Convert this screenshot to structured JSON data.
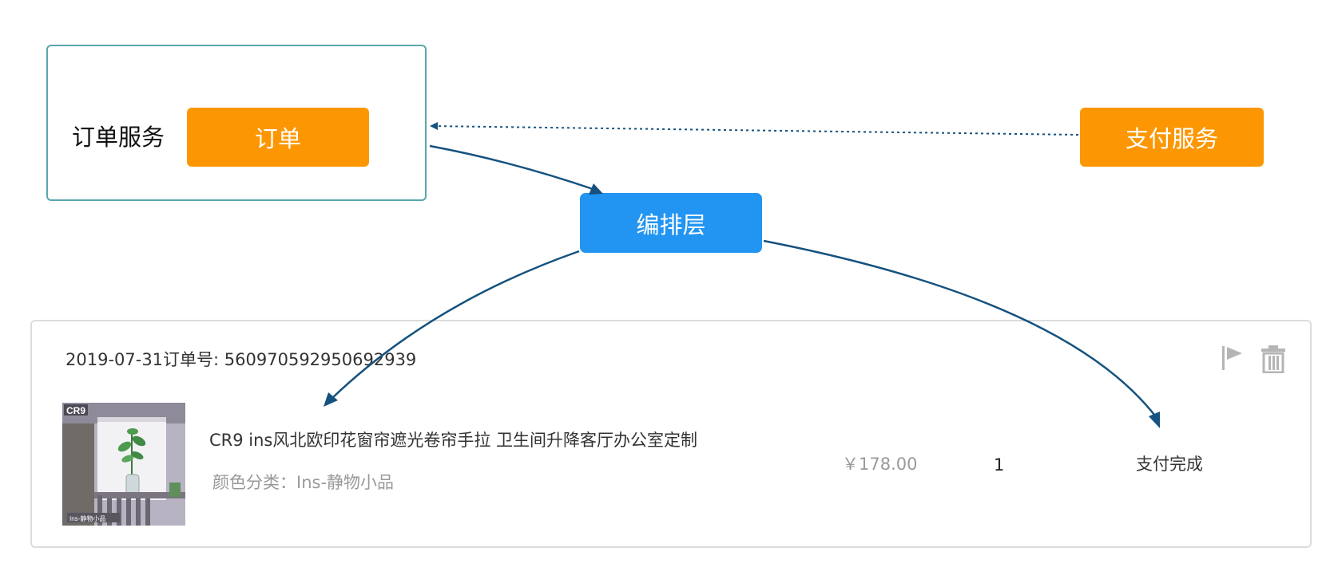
{
  "diagram": {
    "order_service_label": "订单服务",
    "order_button": "订单",
    "payment_service_button": "支付服务",
    "orchestration_layer": "编排层",
    "colors": {
      "service_box_border": "#5aa6ad",
      "service_button": "#fc9703",
      "orchestration": "#2195f1",
      "arrow": "#15527f"
    }
  },
  "order_card": {
    "meta": "2019-07-31订单号: 560970592950692939",
    "product": {
      "thumbnail_brand": "CR9",
      "thumbnail_caption": "Ins-静物小品",
      "title": "CR9 ins风北欧印花窗帘遮光卷帘手拉 卫生间升降客厅办公室定制",
      "variant": "颜色分类：Ins-静物小品"
    },
    "price": "￥178.00",
    "quantity": "1",
    "status": "支付完成",
    "icons": [
      "flag-icon",
      "trash-icon"
    ]
  }
}
